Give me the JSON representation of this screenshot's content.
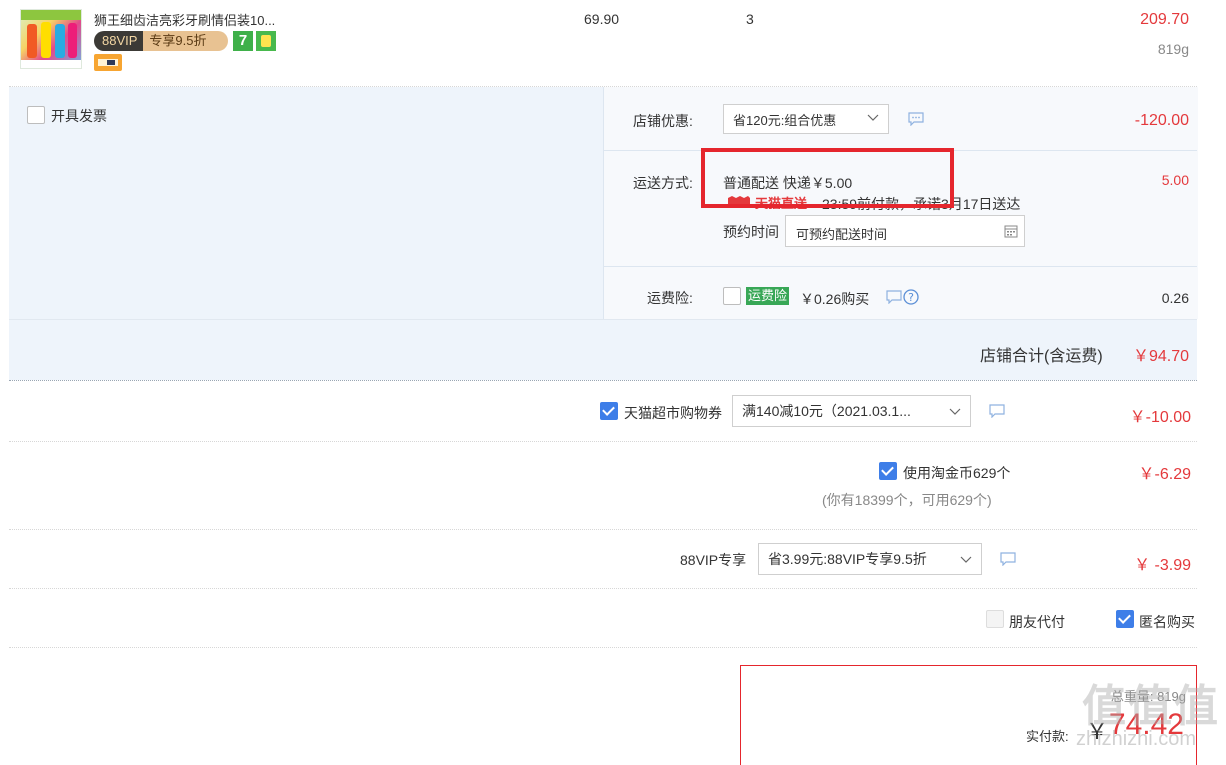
{
  "product": {
    "title": "狮王细齿洁亮彩牙刷情侣装10...",
    "vip_badge_left": "88VIP",
    "vip_badge_right": "专享9.5折",
    "badge_7": "7",
    "unit_price": "69.90",
    "quantity": "3",
    "subtotal": "209.70",
    "weight": "819g"
  },
  "invoice": {
    "label": "开具发票"
  },
  "shop_discount": {
    "label": "店铺优惠:",
    "selected": "省120元:组合优惠",
    "amount": "-120.00"
  },
  "shipping": {
    "label": "运送方式:",
    "method": "普通配送 快递￥5.00",
    "tmall_express": "天猫直送",
    "deadline": "23:59前付款，承诺3月17日送达",
    "reserve_label": "预约时间",
    "reserve_placeholder": "可预约配送时间",
    "amount": "5.00"
  },
  "freight_insurance": {
    "label": "运费险:",
    "tag": "运费险",
    "price": "￥0.26购买",
    "amount": "0.26"
  },
  "shop_total": {
    "label": "店铺合计(含运费)",
    "amount": "￥94.70"
  },
  "coupon": {
    "label": "天猫超市购物券",
    "selected": "满140减10元（2021.03.1...",
    "amount": "￥-10.00"
  },
  "taojinbi": {
    "label": "使用淘金币629个",
    "note": "(你有18399个，可用629个)",
    "amount": "￥-6.29"
  },
  "vip": {
    "label": "88VIP专享",
    "selected": "省3.99元:88VIP专享9.5折",
    "amount": "￥ -3.99"
  },
  "options": {
    "friend_pay": "朋友代付",
    "anonymous": "匿名购买"
  },
  "pay_box": {
    "weight": "总重量: 819g",
    "label": "实付款:",
    "currency": "￥",
    "amount": "74.42"
  },
  "watermark": {
    "text": "值值值",
    "url": "zhizhizhi.com"
  },
  "colors": {
    "accent_red": "#e4393c",
    "checkbox_blue": "#3e7ee8",
    "panel_blue": "#eef4fb",
    "tag_green": "#38a756"
  }
}
